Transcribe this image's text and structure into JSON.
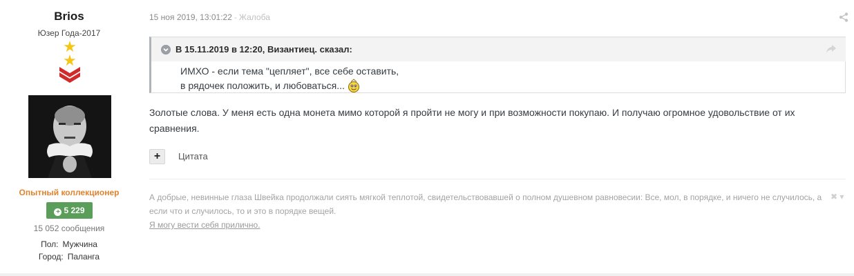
{
  "author": {
    "name": "Brios",
    "title": "Юзер Года-2017",
    "group": "Опытный коллекционер",
    "reputation": "5 229",
    "post_count": "15 052 сообщения",
    "gender_label": "Пол:",
    "gender_value": "Мужчина",
    "city_label": "Город:",
    "city_value": "Паланга",
    "rank_icons": [
      "star-icon",
      "star-icon",
      "double-chevron-icon"
    ]
  },
  "post": {
    "date": "15 ноя 2019, 13:01:22",
    "separator": "-",
    "report": "Жалоба",
    "quote": {
      "citation": "В 15.11.2019 в 12:20, Византиец. сказал:",
      "lines": [
        "ИМХО - если тема \"цепляет\", все себе оставить,",
        "в рядочек положить, и любоваться..."
      ]
    },
    "text": "Золотые слова.  У меня есть одна монета мимо которой я пройти не могу и при возможности покупаю. И получаю огромное удовольствие от их сравнения.",
    "multiquote_label": "+",
    "quote_label": "Цитата"
  },
  "signature": {
    "text": "А добрые, невинные глаза Швейка продолжали сиять мягкой теплотой, свидетельствовавшей о полном душевном равновесии: Все, мол, в порядке, и ничего не случилось, а если что и случилось, то и это в порядке вещей.",
    "link": "Я могу вести себя прилично.",
    "close": "✖ ▾"
  },
  "colors": {
    "group": "#e2822d",
    "reputation_bg": "#5a9e5a",
    "star": "#f5c518",
    "chevron": "#d12a2a"
  }
}
